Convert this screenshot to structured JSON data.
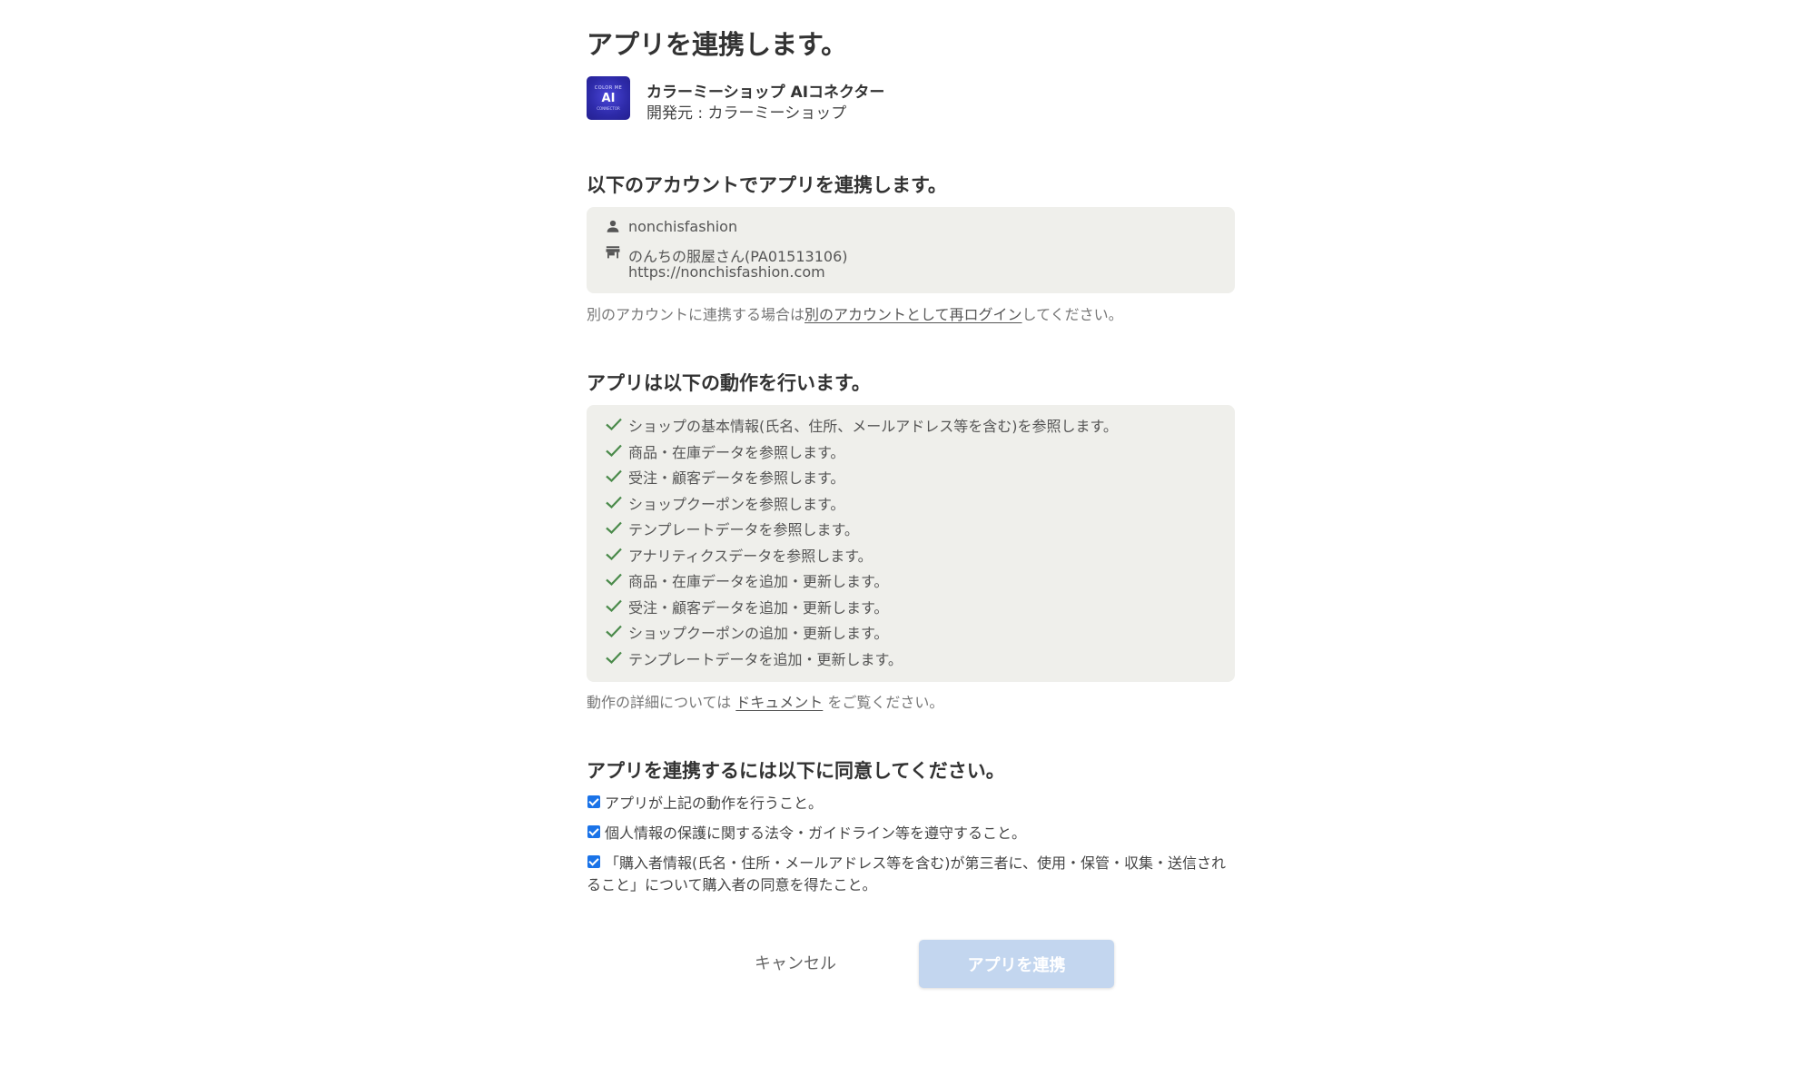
{
  "page_title": "アプリを連携します。",
  "app": {
    "logo_icon": "color-me-ai-logo",
    "logo_lines": [
      "COLOR ME",
      "AI",
      "CONNECTOR"
    ],
    "name": "カラーミーショップ AIコネクター",
    "developer": "開発元 : カラーミーショップ"
  },
  "account_section": {
    "title": "以下のアカウントでアプリを連携します。",
    "username": "nonchisfashion",
    "shop_name": "のんちの服屋さん(PA01513106)",
    "shop_url": "https://nonchisfashion.com",
    "note_prefix": "別のアカウントに連携する場合は",
    "note_link": "別のアカウントとして再ログイン",
    "note_suffix": "してください。"
  },
  "permissions_section": {
    "title": "アプリは以下の動作を行います。",
    "items": [
      "ショップの基本情報(氏名、住所、メールアドレス等を含む)を参照します。",
      "商品・在庫データを参照します。",
      "受注・顧客データを参照します。",
      "ショップクーポンを参照します。",
      "テンプレートデータを参照します。",
      "アナリティクスデータを参照します。",
      "商品・在庫データを追加・更新します。",
      "受注・顧客データを追加・更新します。",
      "ショップクーポンの追加・更新します。",
      "テンプレートデータを追加・更新します。"
    ],
    "note_prefix": "動作の詳細については ",
    "note_link": "ドキュメント",
    "note_suffix": " をご覧ください。"
  },
  "agreement_section": {
    "title": "アプリを連携するには以下に同意してください。",
    "items": [
      "アプリが上記の動作を行うこと。",
      "個人情報の保護に関する法令・ガイドライン等を遵守すること。",
      "「購入者情報(氏名・住所・メールアドレス等を含む)が第三者に、使用・保管・収集・送信されること」について購入者の同意を得たこと。"
    ],
    "checked": [
      true,
      true,
      true
    ]
  },
  "buttons": {
    "cancel": "キャンセル",
    "connect": "アプリを連携"
  },
  "colors": {
    "check_green": "#4a8a4a",
    "box_bg": "#efefeb",
    "connect_disabled": "#c3d6ef",
    "checkbox_blue": "#1a73e8"
  }
}
